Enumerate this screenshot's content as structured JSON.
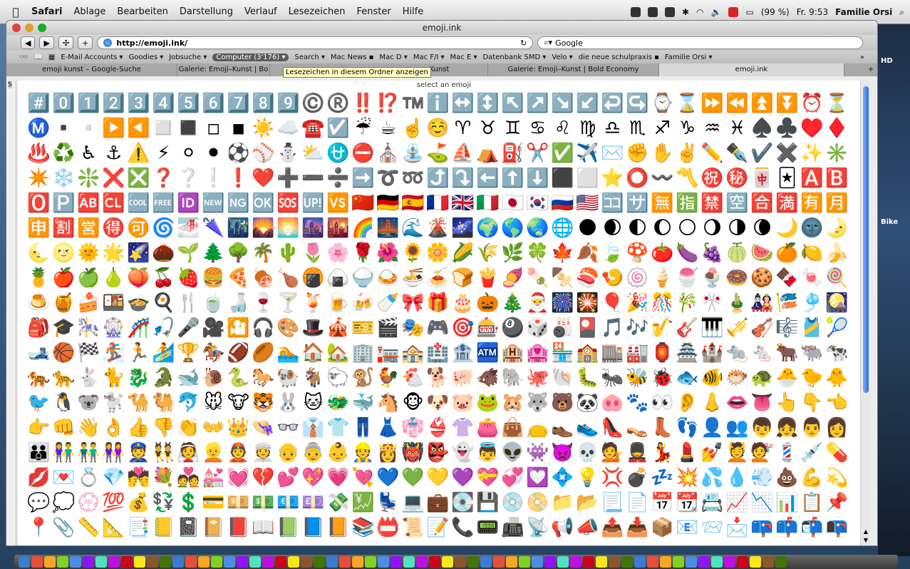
{
  "menubar": {
    "app": "Safari",
    "items": [
      "Ablage",
      "Bearbeiten",
      "Darstellung",
      "Verlauf",
      "Lesezeichen",
      "Fenster",
      "Hilfe"
    ],
    "battery": "(99 %)",
    "clock": "Fr. 9:53",
    "user": "Familie Orsi"
  },
  "window": {
    "title": "emoji.ink",
    "url": "http://emoji.ink/",
    "search_placeholder": "Google"
  },
  "bookmarks": [
    {
      "label": "E-Mail Accounts ▾",
      "active": false
    },
    {
      "label": "Goodies ▾",
      "active": false
    },
    {
      "label": "Jobsuche ▾",
      "active": false
    },
    {
      "label": "Computer (3'176) ▾",
      "active": true
    },
    {
      "label": "Search ▾",
      "active": false
    },
    {
      "label": "Mac News ▪",
      "active": false
    },
    {
      "label": "Mac D ▾",
      "active": false
    },
    {
      "label": "Mac F/I ▾",
      "active": false
    },
    {
      "label": "Mac E ▾",
      "active": false
    },
    {
      "label": "Datenbank SMD ▾",
      "active": false
    },
    {
      "label": "Velo ▾",
      "active": false
    },
    {
      "label": "die neue schulpraxis ▪",
      "active": false
    },
    {
      "label": "Familie Orsi ▾",
      "active": false
    }
  ],
  "tooltip": "Lesezeichen in diesem Ordner anzeigen",
  "tabs": [
    {
      "label": "emoji kunst – Google-Suche",
      "active": false
    },
    {
      "label": "Galerie: Emoji–Kunst | Bo",
      "active": false
    },
    {
      "label": "er Kunst",
      "active": false
    },
    {
      "label": "Galerie: Emoji–Kunst | Bold Economy",
      "active": false
    },
    {
      "label": "emoji.ink",
      "active": true
    }
  ],
  "page": {
    "heading": "select an emoji"
  },
  "emojis": [
    "#️⃣",
    "0️⃣",
    "1️⃣",
    "2️⃣",
    "3️⃣",
    "4️⃣",
    "5️⃣",
    "6️⃣",
    "7️⃣",
    "8️⃣",
    "9️⃣",
    "©️",
    "®️",
    "‼️",
    "⁉️",
    "™️",
    "ℹ️",
    "↔️",
    "↕️",
    "↖️",
    "↗️",
    "↘️",
    "↙️",
    "↩️",
    "↪️",
    "⌚",
    "⌛",
    "⏩",
    "⏪",
    "⏫",
    "⏬",
    "⏰",
    "⏳",
    "Ⓜ️",
    "▪️",
    "▫️",
    "▶️",
    "◀️",
    "◻️",
    "◼️",
    "◽",
    "◾",
    "☀️",
    "☁️",
    "☎️",
    "☑️",
    "☔",
    "☕",
    "☝️",
    "☺️",
    "♈",
    "♉",
    "♊",
    "♋",
    "♌",
    "♍",
    "♎",
    "♏",
    "♐",
    "♑",
    "♒",
    "♓",
    "♠️",
    "♣️",
    "♥️",
    "♦️",
    "♨️",
    "♻️",
    "♿",
    "⚓",
    "⚠️",
    "⚡",
    "⚪",
    "⚫",
    "⚽",
    "⚾",
    "⛄",
    "⛅",
    "⛎",
    "⛔",
    "⛪",
    "⛲",
    "⛳",
    "⛵",
    "⛺",
    "⛽",
    "✂️",
    "✅",
    "✈️",
    "✉️",
    "✊",
    "✋",
    "✌️",
    "✏️",
    "✒️",
    "✔️",
    "✖️",
    "✨",
    "✳️",
    "✴️",
    "❄️",
    "❇️",
    "❌",
    "❎",
    "❓",
    "❔",
    "❕",
    "❗",
    "❤️",
    "➕",
    "➖",
    "➗",
    "➡️",
    "➰",
    "➿",
    "⤴️",
    "⤵️",
    "⬅️",
    "⬆️",
    "⬇️",
    "⬛",
    "⬜",
    "⭐",
    "⭕",
    "〰️",
    "〽️",
    "㊗️",
    "㊙️",
    "🀄",
    "🃏",
    "🅰️",
    "🅱️",
    "🅾️",
    "🅿️",
    "🆎",
    "🆑",
    "🆒",
    "🆓",
    "🆔",
    "🆕",
    "🆖",
    "🆗",
    "🆘",
    "🆙",
    "🆚",
    "🇨🇳",
    "🇩🇪",
    "🇪🇸",
    "🇫🇷",
    "🇬🇧",
    "🇮🇹",
    "🇯🇵",
    "🇰🇷",
    "🇷🇺",
    "🇺🇸",
    "🈁",
    "🈂️",
    "🈚",
    "🈯",
    "🈲",
    "🈳",
    "🈴",
    "🈵",
    "🈶",
    "🈷️",
    "🈸",
    "🈹",
    "🈺",
    "🉐",
    "🉑",
    "🌀",
    "🌁",
    "🌂",
    "🌃",
    "🌄",
    "🌅",
    "🌆",
    "🌇",
    "🌈",
    "🌉",
    "🌊",
    "🌋",
    "🌌",
    "🌍",
    "🌎",
    "🌏",
    "🌐",
    "🌑",
    "🌒",
    "🌓",
    "🌔",
    "🌕",
    "🌖",
    "🌗",
    "🌘",
    "🌙",
    "🌚",
    "🌛",
    "🌜",
    "🌝",
    "🌞",
    "🌟",
    "🌠",
    "🌰",
    "🌱",
    "🌲",
    "🌳",
    "🌴",
    "🌵",
    "🌷",
    "🌸",
    "🌹",
    "🌺",
    "🌻",
    "🌼",
    "🌽",
    "🌾",
    "🌿",
    "🍀",
    "🍁",
    "🍂",
    "🍃",
    "🍄",
    "🍅",
    "🍆",
    "🍇",
    "🍈",
    "🍉",
    "🍊",
    "🍋",
    "🍌",
    "🍍",
    "🍎",
    "🍏",
    "🍐",
    "🍑",
    "🍒",
    "🍓",
    "🍔",
    "🍕",
    "🍖",
    "🍗",
    "🍘",
    "🍙",
    "🍚",
    "🍛",
    "🍜",
    "🍝",
    "🍞",
    "🍟",
    "🍠",
    "🍡",
    "🍢",
    "🍣",
    "🍤",
    "🍥",
    "🍦",
    "🍧",
    "🍨",
    "🍩",
    "🍪",
    "🍫",
    "🍬",
    "🍭",
    "🍮",
    "🍯",
    "🍰",
    "🍱",
    "🍲",
    "🍳",
    "🍴",
    "🍵",
    "🍶",
    "🍷",
    "🍸",
    "🍹",
    "🍺",
    "🍻",
    "🍼",
    "🎀",
    "🎁",
    "🎂",
    "🎃",
    "🎄",
    "🎅",
    "🎆",
    "🎇",
    "🎈",
    "🎉",
    "🎊",
    "🎋",
    "🎌",
    "🎍",
    "🎎",
    "🎏",
    "🎐",
    "🎑",
    "🎒",
    "🎓",
    "🎠",
    "🎡",
    "🎢",
    "🎣",
    "🎤",
    "🎥",
    "🎦",
    "🎧",
    "🎨",
    "🎩",
    "🎪",
    "🎫",
    "🎬",
    "🎭",
    "🎮",
    "🎯",
    "🎰",
    "🎱",
    "🎲",
    "🎳",
    "🎴",
    "🎵",
    "🎶",
    "🎷",
    "🎸",
    "🎹",
    "🎺",
    "🎻",
    "🎼",
    "🎽",
    "🎾",
    "🎿",
    "🏀",
    "🏁",
    "🏂",
    "🏃",
    "🏄",
    "🏆",
    "🏇",
    "🏈",
    "🏉",
    "🏊",
    "🏠",
    "🏡",
    "🏢",
    "🏣",
    "🏤",
    "🏥",
    "🏦",
    "🏧",
    "🏨",
    "🏩",
    "🏪",
    "🏫",
    "🏬",
    "🏭",
    "🏮",
    "🏯",
    "🏰",
    "🐀",
    "🐁",
    "🐂",
    "🐃",
    "🐄",
    "🐅",
    "🐆",
    "🐇",
    "🐈",
    "🐉",
    "🐊",
    "🐋",
    "🐌",
    "🐍",
    "🐎",
    "🐏",
    "🐐",
    "🐑",
    "🐒",
    "🐓",
    "🐔",
    "🐕",
    "🐖",
    "🐗",
    "🐘",
    "🐙",
    "🐚",
    "🐛",
    "🐜",
    "🐝",
    "🐞",
    "🐟",
    "🐠",
    "🐡",
    "🐢",
    "🐣",
    "🐤",
    "🐥",
    "🐦",
    "🐧",
    "🐨",
    "🐩",
    "🐪",
    "🐫",
    "🐬",
    "🐭",
    "🐮",
    "🐯",
    "🐰",
    "🐱",
    "🐲",
    "🐳",
    "🐴",
    "🐵",
    "🐶",
    "🐷",
    "🐸",
    "🐹",
    "🐺",
    "🐻",
    "🐼",
    "🐽",
    "🐾",
    "👀",
    "👂",
    "👃",
    "👄",
    "👅",
    "👆",
    "👇",
    "👈",
    "👉",
    "👊",
    "👋",
    "👌",
    "👍",
    "👎",
    "👏",
    "👐",
    "👑",
    "👒",
    "👓",
    "👔",
    "👕",
    "👖",
    "👗",
    "👘",
    "👙",
    "👚",
    "👛",
    "👜",
    "👝",
    "👞",
    "👟",
    "👠",
    "👡",
    "👢",
    "👣",
    "👤",
    "👥",
    "👦",
    "👧",
    "👨",
    "👩",
    "👪",
    "👫",
    "👬",
    "👭",
    "👮",
    "👯",
    "👰",
    "👱",
    "👲",
    "👳",
    "👴",
    "👵",
    "👶",
    "👷",
    "👸",
    "👹",
    "👺",
    "👻",
    "👼",
    "👽",
    "👾",
    "👿",
    "💀",
    "💁",
    "💂",
    "💃",
    "💄",
    "💅",
    "💆",
    "💇",
    "💈",
    "💉",
    "💊",
    "💋",
    "💌",
    "💍",
    "💎",
    "💏",
    "💐",
    "💑",
    "💒",
    "💓",
    "💔",
    "💕",
    "💖",
    "💗",
    "💘",
    "💙",
    "💚",
    "💛",
    "💜",
    "💝",
    "💞",
    "💟",
    "💠",
    "💡",
    "💢",
    "💣",
    "💤",
    "💥",
    "💦",
    "💧",
    "💨",
    "💩",
    "💪",
    "💫",
    "💬",
    "💭",
    "💮",
    "💯",
    "💰",
    "💱",
    "💲",
    "💳",
    "💴",
    "💵",
    "💶",
    "💷",
    "💸",
    "💹",
    "💺",
    "💻",
    "💼",
    "💽",
    "💾",
    "💿",
    "📀",
    "📁",
    "📂",
    "📃",
    "📄",
    "📅",
    "📆",
    "📇",
    "📈",
    "📉",
    "📊",
    "📋",
    "📌",
    "📍",
    "📎",
    "📏",
    "📐",
    "📑",
    "📒",
    "📓",
    "📔",
    "📕",
    "📖",
    "📗",
    "📘",
    "📙",
    "📚",
    "📛",
    "📜",
    "📝",
    "📞",
    "📟",
    "📠",
    "📡",
    "📢",
    "📣",
    "📤",
    "📥",
    "📦",
    "📧",
    "📨",
    "📩",
    "📪",
    "📫",
    "📬",
    "📭"
  ]
}
